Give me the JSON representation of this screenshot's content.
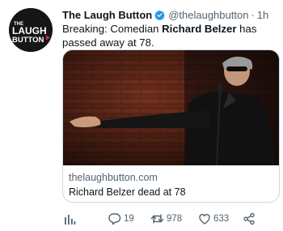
{
  "account": {
    "display_name": "The Laugh Button",
    "handle": "@thelaughbutton",
    "separator": "·",
    "time": "1h",
    "avatar_text": [
      "THE",
      "LAUGH",
      "BUTTON"
    ]
  },
  "tweet": {
    "text_before": "Breaking: Comedian ",
    "text_bold": "Richard Belzer",
    "text_after": " has passed away at 78."
  },
  "card": {
    "domain": "thelaughbutton.com",
    "title": "Richard Belzer dead at 78"
  },
  "actions": {
    "replies": "19",
    "retweets": "978",
    "likes": "633"
  },
  "colors": {
    "text": "#0f1419",
    "secondary": "#536471",
    "verified": "#1d9bf0",
    "border": "#cfd9de",
    "avatar_accent": "#e0245e"
  },
  "icons": {
    "verified": "verified-badge-icon",
    "more": "more-dots-icon",
    "analytics": "analytics-icon",
    "reply": "reply-icon",
    "retweet": "retweet-icon",
    "like": "heart-icon",
    "share": "share-icon"
  }
}
